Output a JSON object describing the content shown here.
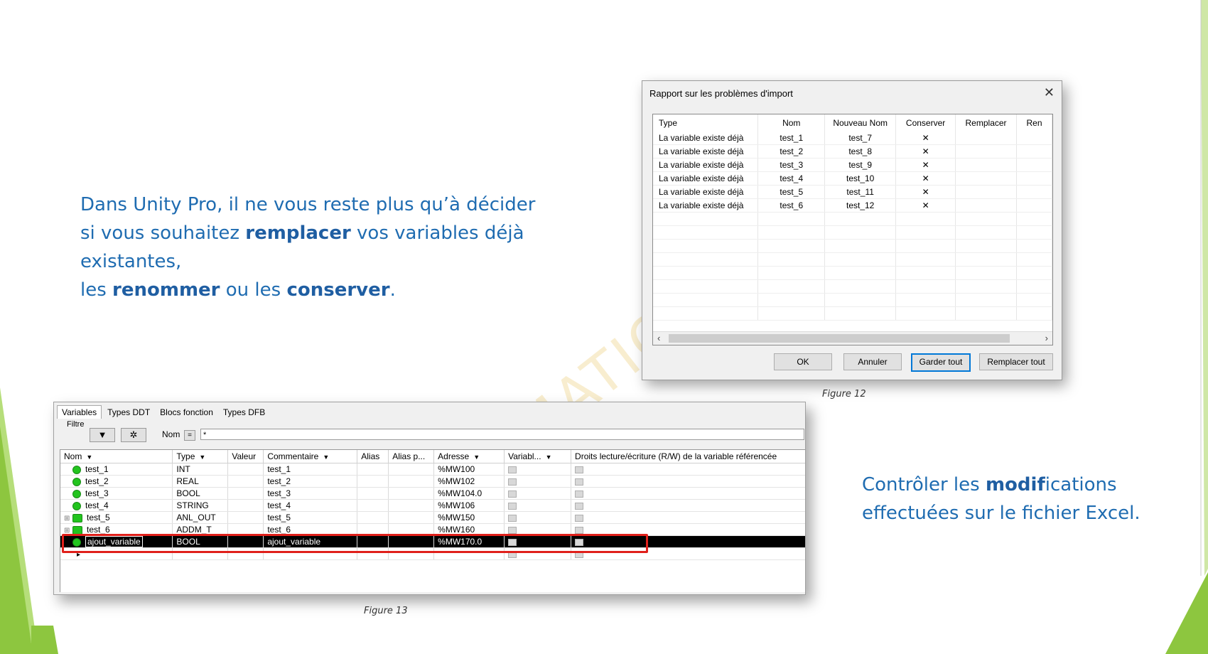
{
  "slide": {
    "intro_lines": [
      {
        "segments": [
          {
            "text": "Dans Unity Pro, il ne vous reste plus qu’à décider",
            "bold": false
          }
        ]
      },
      {
        "segments": [
          {
            "text": "si vous souhaitez ",
            "bold": false
          },
          {
            "text": "remplacer",
            "bold": true
          },
          {
            "text": " vos variables déjà existantes,",
            "bold": false
          }
        ]
      },
      {
        "segments": [
          {
            "text": "les ",
            "bold": false
          },
          {
            "text": "renommer",
            "bold": true
          },
          {
            "text": " ou les ",
            "bold": false
          },
          {
            "text": "conserver",
            "bold": true
          },
          {
            "text": ".",
            "bold": false
          }
        ]
      }
    ],
    "control_lines": [
      {
        "segments": [
          {
            "text": "Contrôler les ",
            "bold": false
          },
          {
            "text": "modif",
            "bold": true
          },
          {
            "text": "ications",
            "bold": false
          }
        ]
      },
      {
        "segments": [
          {
            "text": "effectuées sur le fichier Excel.",
            "bold": false
          }
        ]
      }
    ],
    "caption_fig12": "Figure 12",
    "caption_fig13": "Figure 13",
    "watermark": "MATION",
    "colors": {
      "text_blue": "#1f6cb1",
      "accent_green": "#8dc63f",
      "highlight_red": "#e0201b"
    }
  },
  "dialog": {
    "title": "Rapport sur les problèmes d'import",
    "columns": [
      "Type",
      "Nom",
      "Nouveau Nom",
      "Conserver",
      "Remplacer",
      "Ren"
    ],
    "rows": [
      {
        "type": "La variable existe déjà",
        "nom": "test_1",
        "nouveau": "test_7",
        "conserver": "✕"
      },
      {
        "type": "La variable existe déjà",
        "nom": "test_2",
        "nouveau": "test_8",
        "conserver": "✕"
      },
      {
        "type": "La variable existe déjà",
        "nom": "test_3",
        "nouveau": "test_9",
        "conserver": "✕"
      },
      {
        "type": "La variable existe déjà",
        "nom": "test_4",
        "nouveau": "test_10",
        "conserver": "✕"
      },
      {
        "type": "La variable existe déjà",
        "nom": "test_5",
        "nouveau": "test_11",
        "conserver": "✕"
      },
      {
        "type": "La variable existe déjà",
        "nom": "test_6",
        "nouveau": "test_12",
        "conserver": "✕"
      }
    ],
    "buttons": {
      "ok": "OK",
      "cancel": "Annuler",
      "keep_all": "Garder tout",
      "replace_all": "Remplacer tout"
    }
  },
  "editor": {
    "tabs": [
      "Variables",
      "Types DDT",
      "Blocs fonction",
      "Types DFB"
    ],
    "filter_label": "Filtre",
    "nom_label": "Nom",
    "eq_label": "=",
    "filter_value": "*",
    "columns": [
      "Nom",
      "Type",
      "Valeur",
      "Commentaire",
      "Alias",
      "Alias p...",
      "Adresse",
      "Variabl...",
      "Droits lecture/écriture (R/W) de la variable référencée"
    ],
    "rows": [
      {
        "name": "test_1",
        "type": "INT",
        "comment": "test_1",
        "address": "%MW100",
        "expand": false
      },
      {
        "name": "test_2",
        "type": "REAL",
        "comment": "test_2",
        "address": "%MW102",
        "expand": false
      },
      {
        "name": "test_3",
        "type": "BOOL",
        "comment": "test_3",
        "address": "%MW104.0",
        "expand": false
      },
      {
        "name": "test_4",
        "type": "STRING",
        "comment": "test_4",
        "address": "%MW106",
        "expand": false
      },
      {
        "name": "test_5",
        "type": "ANL_OUT",
        "comment": "test_5",
        "address": "%MW150",
        "expand": true
      },
      {
        "name": "test_6",
        "type": "ADDM_T",
        "comment": "test_6",
        "address": "%MW160",
        "expand": true
      },
      {
        "name": "ajout_variable",
        "type": "BOOL",
        "comment": "ajout_variable",
        "address": "%MW170.0",
        "expand": false,
        "selected": true
      }
    ]
  }
}
